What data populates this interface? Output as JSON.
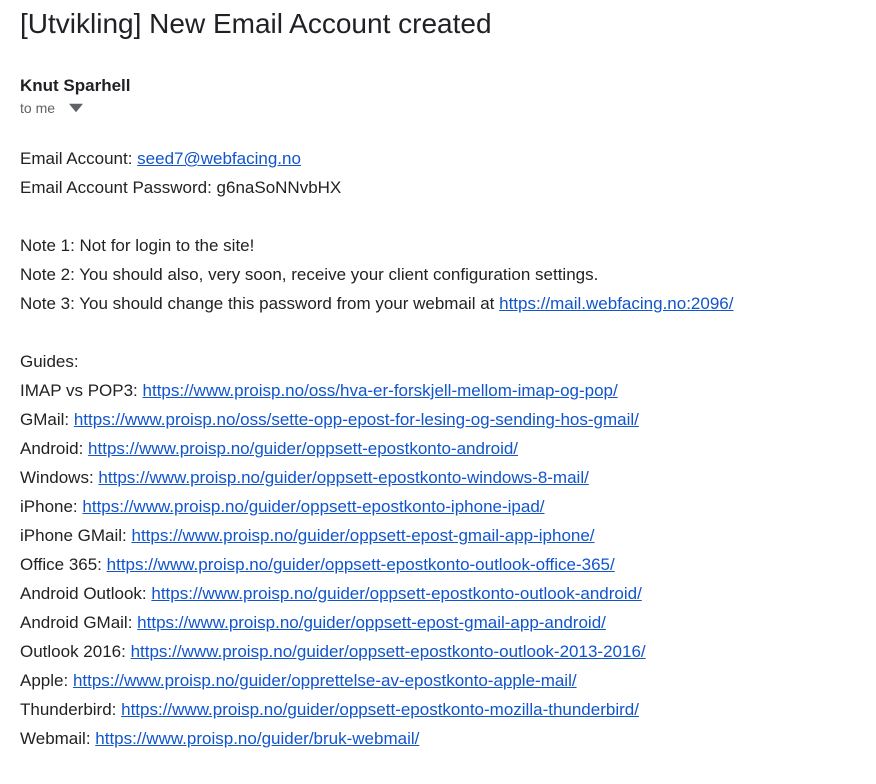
{
  "subject": "[Utvikling] New Email Account created",
  "sender": {
    "name": "Knut Sparhell"
  },
  "recipients_label": "to me",
  "account": {
    "label": "Email Account: ",
    "email_link": "seed7@webfacing.no",
    "password_label": "Email Account Password: ",
    "password_value": "g6naSoNNvbHX"
  },
  "notes": {
    "n1": "Note 1: Not for login to the site!",
    "n2": "Note 2: You should also, very soon, receive your client configuration settings.",
    "n3_prefix": "Note 3: You should change this password from your webmail at ",
    "n3_link": "https://mail.webfacing.no:2096/"
  },
  "guides_header": "Guides:",
  "guides": [
    {
      "label": "IMAP vs POP3: ",
      "url": "https://www.proisp.no/oss/hva-er-forskjell-mellom-imap-og-pop/"
    },
    {
      "label": "GMail: ",
      "url": "https://www.proisp.no/oss/sette-opp-epost-for-lesing-og-sending-hos-gmail/"
    },
    {
      "label": "Android: ",
      "url": "https://www.proisp.no/guider/oppsett-epostkonto-android/"
    },
    {
      "label": "Windows: ",
      "url": "https://www.proisp.no/guider/oppsett-epostkonto-windows-8-mail/"
    },
    {
      "label": "iPhone: ",
      "url": "https://www.proisp.no/guider/oppsett-epostkonto-iphone-ipad/"
    },
    {
      "label": "iPhone GMail: ",
      "url": "https://www.proisp.no/guider/oppsett-epost-gmail-app-iphone/"
    },
    {
      "label": "Office 365: ",
      "url": "https://www.proisp.no/guider/oppsett-epostkonto-outlook-office-365/"
    },
    {
      "label": "Android Outlook: ",
      "url": "https://www.proisp.no/guider/oppsett-epostkonto-outlook-android/"
    },
    {
      "label": "Android GMail: ",
      "url": "https://www.proisp.no/guider/oppsett-epost-gmail-app-android/"
    },
    {
      "label": "Outlook 2016: ",
      "url": "https://www.proisp.no/guider/oppsett-epostkonto-outlook-2013-2016/"
    },
    {
      "label": "Apple: ",
      "url": "https://www.proisp.no/guider/opprettelse-av-epostkonto-apple-mail/"
    },
    {
      "label": "Thunderbird: ",
      "url": "https://www.proisp.no/guider/oppsett-epostkonto-mozilla-thunderbird/"
    },
    {
      "label": "Webmail: ",
      "url": "https://www.proisp.no/guider/bruk-webmail/"
    }
  ]
}
